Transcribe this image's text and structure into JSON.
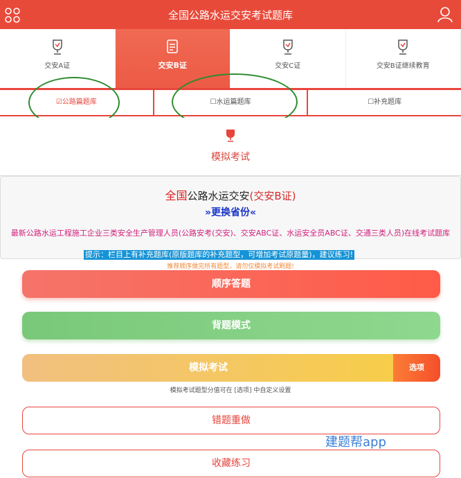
{
  "app": {
    "title": "全国公路水运交安考试题库"
  },
  "icons": {
    "menu": "grid-icon",
    "user": "user-icon",
    "cert": "trophy-icon",
    "active_cert": "document-icon"
  },
  "cert_tabs": [
    {
      "label": "交安A证"
    },
    {
      "label": "交安B证",
      "active": true
    },
    {
      "label": "交安C证"
    },
    {
      "label": "交安B证继续教育"
    }
  ],
  "banks": [
    {
      "label": "☑公路篇题库"
    },
    {
      "label": "☐水运篇题库"
    },
    {
      "label": "☐补充题库"
    }
  ],
  "mock": {
    "label": "模拟考试"
  },
  "info": {
    "head_prefix": "全国",
    "head_main": "公路水运交安",
    "head_suffix": "(交安B证)",
    "switch": "»更换省份«",
    "desc": "最新公路水运工程施工企业三类安全生产管理人员(公路安考(交安)、交安ABC证、水运安全员ABC证、交通三类人员)在线考试题库",
    "tip": "提示：栏目上有补充题库(原版题库的补充题型，可增加考试原题量)，建议练习!",
    "hint": "推荐顺序做完所有题型，请勿仅模拟考试刷题!"
  },
  "buttons": {
    "sequential": "顺序答题",
    "memorize": "背题模式",
    "mock_exam": "模拟考试",
    "options": "选项",
    "options_note": "模拟考试题型分值可在 [选项] 中自定义设置",
    "wrong": "错题重做",
    "favorites": "收藏练习"
  },
  "watermark": "建题帮app",
  "colors": {
    "brand": "#e8453c",
    "green": "#7ccb7c",
    "yellow": "#f4c95a",
    "orange": "#f55a2d"
  }
}
